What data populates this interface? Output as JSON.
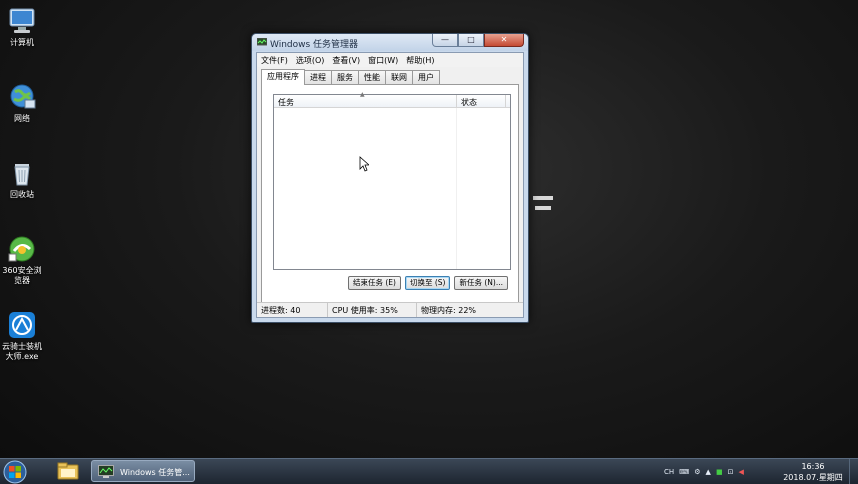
{
  "desktop": {
    "icons": [
      {
        "label": "计算机",
        "icon": "computer-icon"
      },
      {
        "label": "网络",
        "icon": "network-globe-icon"
      },
      {
        "label": "回收站",
        "icon": "recycle-bin-icon"
      },
      {
        "label": "360安全浏览器",
        "icon": "360-browser-icon"
      },
      {
        "label": "云骑士装机大师.exe",
        "icon": "yunqishi-installer-icon"
      }
    ]
  },
  "window": {
    "title": "Windows 任务管理器",
    "menu": [
      "文件(F)",
      "选项(O)",
      "查看(V)",
      "窗口(W)",
      "帮助(H)"
    ],
    "tabs": [
      "应用程序",
      "进程",
      "服务",
      "性能",
      "联网",
      "用户"
    ],
    "active_tab": "应用程序",
    "list": {
      "columns": {
        "task": "任务",
        "status": "状态"
      },
      "rows": []
    },
    "buttons": {
      "end_task": "结束任务 (E)",
      "switch_to": "切换至 (S)",
      "new_task": "新任务 (N)..."
    },
    "statusbar": {
      "processes": "进程数: 40",
      "cpu": "CPU 使用率: 35%",
      "memory": "物理内存: 22%"
    },
    "controls": {
      "minimize": "—",
      "maximize": "□",
      "close": "✕"
    }
  },
  "taskbar": {
    "active_task_label": "Windows 任务管...",
    "tray": {
      "lang": "CH"
    },
    "clock": {
      "time": "16:36",
      "date": "2018.07.星期四"
    }
  },
  "colors": {
    "taskbar": "#1d2530",
    "window_frame": "#c9d9ec",
    "close_button": "#c44a33"
  }
}
